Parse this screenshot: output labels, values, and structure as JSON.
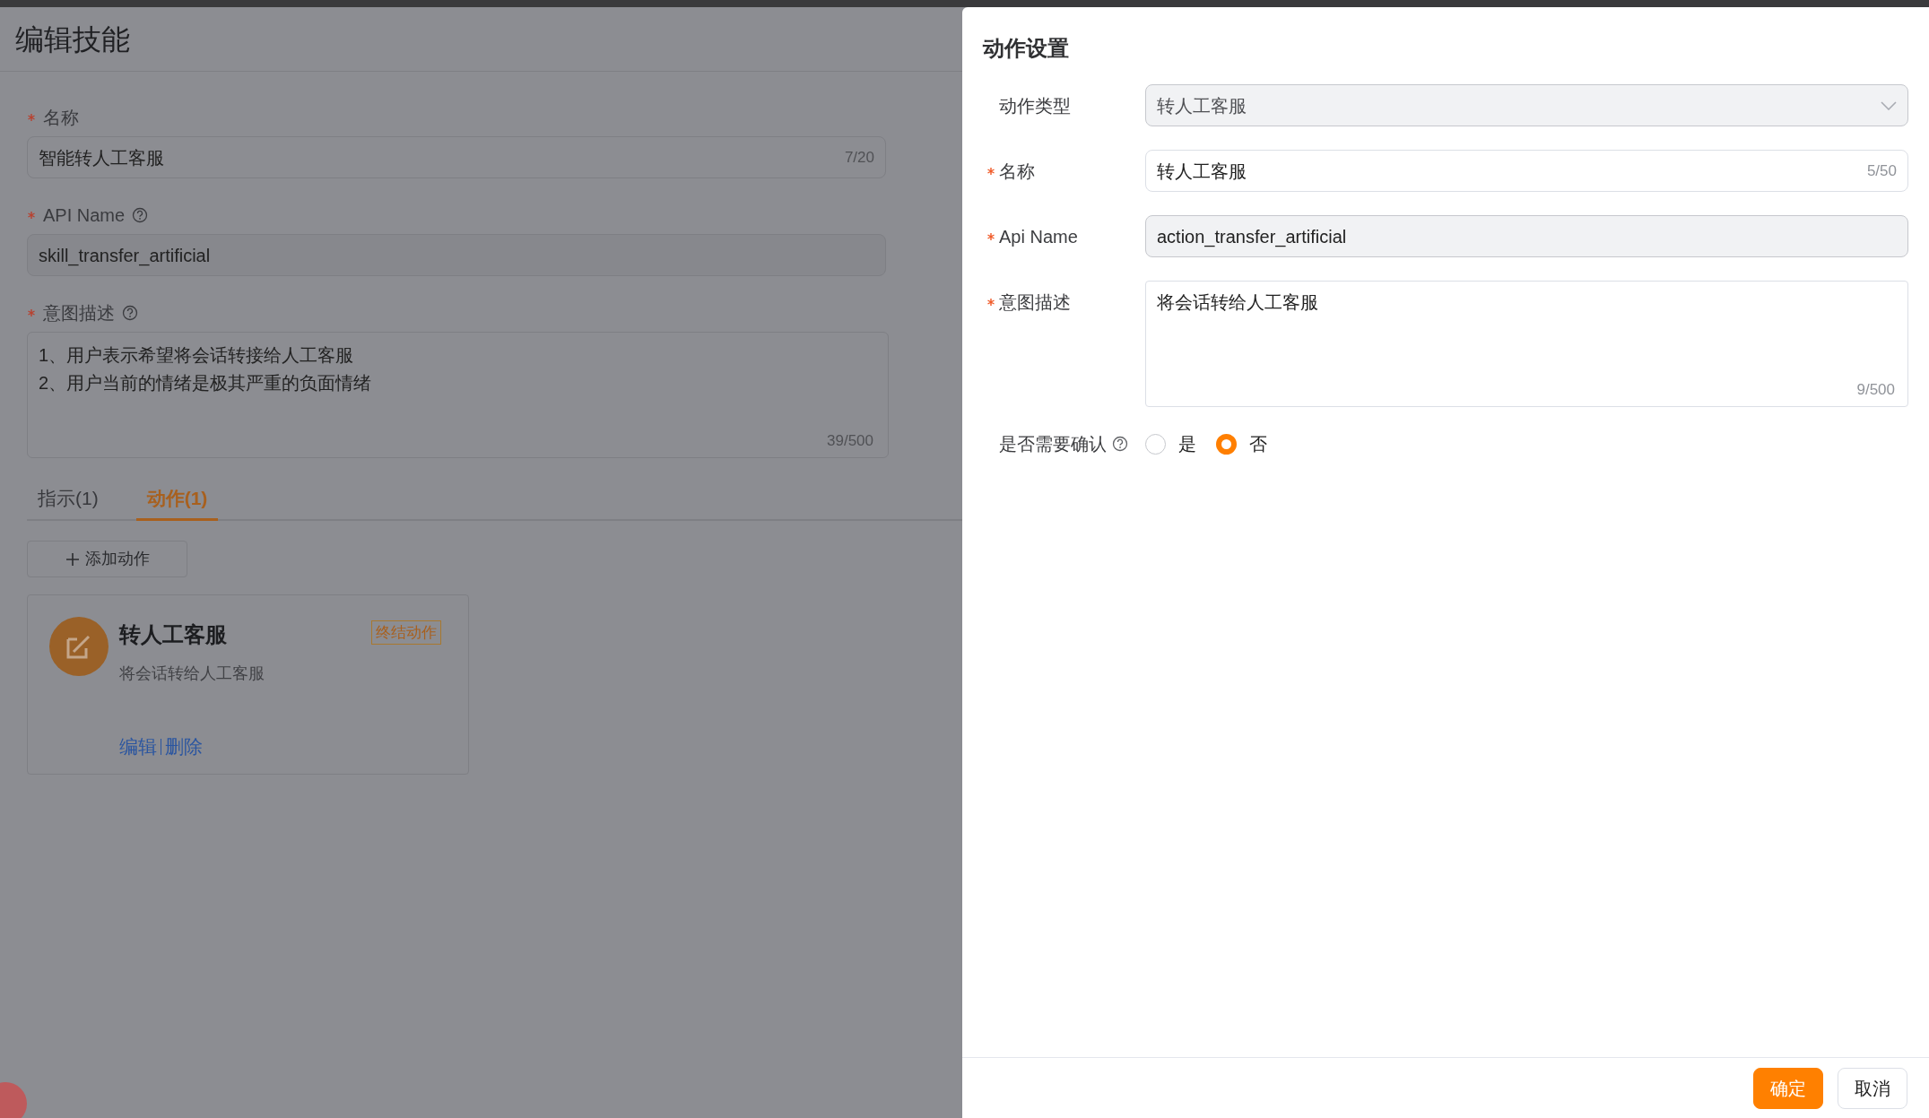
{
  "page": {
    "title": "编辑技能",
    "fields": [
      {
        "kind": "input",
        "label": "名称",
        "required": true,
        "help": false,
        "value": "智能转人工客服",
        "counter": "7/20"
      },
      {
        "kind": "readonly",
        "label": "API Name",
        "required": true,
        "help": true,
        "value": "skill_transfer_artificial"
      },
      {
        "kind": "textarea",
        "label": "意图描述",
        "required": true,
        "help": true,
        "value": "1、用户表示希望将会话转接给人工客服\n2、用户当前的情绪是极其严重的负面情绪",
        "counter": "39/500"
      }
    ],
    "tabs": [
      {
        "label": "指示(1)",
        "selected": false
      },
      {
        "label": "动作(1)",
        "selected": true
      }
    ],
    "add_button": "添加动作",
    "action_cards": [
      {
        "title": "转人工客服",
        "tag": "终结动作",
        "description": "将会话转给人工客服",
        "links": [
          "编辑",
          "删除"
        ]
      }
    ]
  },
  "drawer": {
    "title": "动作设置",
    "fields": [
      {
        "kind": "select",
        "label": "动作类型",
        "required": false,
        "value": "转人工客服"
      },
      {
        "kind": "input",
        "label": "名称",
        "required": true,
        "value": "转人工客服",
        "counter": "5/50"
      },
      {
        "kind": "readonly",
        "label": "Api Name",
        "required": true,
        "value": "action_transfer_artificial"
      },
      {
        "kind": "textarea",
        "label": "意图描述",
        "required": true,
        "value": "将会话转给人工客服",
        "counter": "9/500"
      }
    ],
    "confirm": {
      "label": "是否需要确认",
      "help": true,
      "options": [
        {
          "label": "是",
          "selected": false
        },
        {
          "label": "否",
          "selected": true
        }
      ]
    },
    "buttons": [
      {
        "label": "确定",
        "kind": "primary"
      },
      {
        "label": "取消",
        "kind": "default"
      }
    ]
  }
}
